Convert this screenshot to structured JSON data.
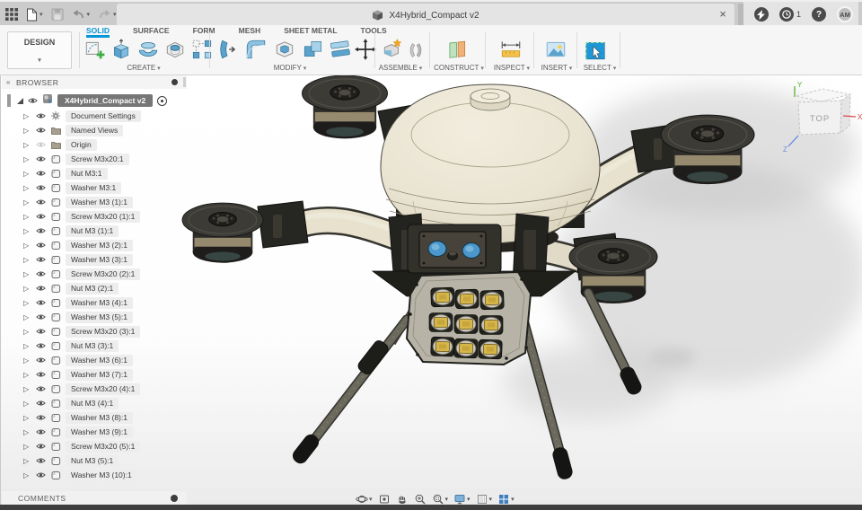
{
  "appbar": {
    "document_tab": "X4Hybrid_Compact v2",
    "job_count": "1",
    "help_label": "?",
    "avatar": "AM",
    "left_icons": [
      "app-grid",
      "file-new",
      "save",
      "undo",
      "redo"
    ],
    "right_icons": [
      "close-tab",
      "new-tab",
      "extensions",
      "job-status",
      "help",
      "account"
    ]
  },
  "ribbon": {
    "design_label": "DESIGN",
    "accent_color": "#0696d7",
    "tabs": [
      {
        "label": "SOLID",
        "active": true
      },
      {
        "label": "SURFACE",
        "active": false
      },
      {
        "label": "FORM",
        "active": false
      },
      {
        "label": "MESH",
        "active": false
      },
      {
        "label": "SHEET METAL",
        "active": false
      },
      {
        "label": "TOOLS",
        "active": false
      }
    ],
    "groups": {
      "create": "CREATE",
      "modify": "MODIFY",
      "assemble": "ASSEMBLE",
      "construct": "CONSTRUCT",
      "inspect": "INSPECT",
      "insert": "INSERT",
      "select": "SELECT"
    },
    "create_tools": [
      "create-sketch",
      "extrude",
      "revolve",
      "hole",
      "pattern"
    ],
    "modify_tools": [
      "press-pull",
      "fillet",
      "shell",
      "combine",
      "split-body",
      "move-copy"
    ],
    "assemble_tools": [
      "new-component",
      "joint"
    ]
  },
  "browser": {
    "title": "BROWSER",
    "root": {
      "label": "X4Hybrid_Compact v2",
      "selected": true
    },
    "items": [
      {
        "label": "Document Settings",
        "icon": "gear"
      },
      {
        "label": "Named Views",
        "icon": "folder"
      },
      {
        "label": "Origin",
        "icon": "folder",
        "hidden": true
      },
      {
        "label": "Screw M3x20:1",
        "icon": "component"
      },
      {
        "label": "Nut M3:1",
        "icon": "component"
      },
      {
        "label": "Washer M3:1",
        "icon": "component"
      },
      {
        "label": "Washer M3 (1):1",
        "icon": "component"
      },
      {
        "label": "Screw M3x20 (1):1",
        "icon": "component"
      },
      {
        "label": "Nut M3 (1):1",
        "icon": "component"
      },
      {
        "label": "Washer M3 (2):1",
        "icon": "component"
      },
      {
        "label": "Washer M3 (3):1",
        "icon": "component"
      },
      {
        "label": "Screw M3x20 (2):1",
        "icon": "component"
      },
      {
        "label": "Nut M3 (2):1",
        "icon": "component"
      },
      {
        "label": "Washer M3 (4):1",
        "icon": "component"
      },
      {
        "label": "Washer M3 (5):1",
        "icon": "component"
      },
      {
        "label": "Screw M3x20 (3):1",
        "icon": "component"
      },
      {
        "label": "Nut M3 (3):1",
        "icon": "component"
      },
      {
        "label": "Washer M3 (6):1",
        "icon": "component"
      },
      {
        "label": "Washer M3 (7):1",
        "icon": "component"
      },
      {
        "label": "Screw M3x20 (4):1",
        "icon": "component"
      },
      {
        "label": "Nut M3 (4):1",
        "icon": "component"
      },
      {
        "label": "Washer M3 (8):1",
        "icon": "component"
      },
      {
        "label": "Washer M3 (9):1",
        "icon": "component"
      },
      {
        "label": "Screw M3x20 (5):1",
        "icon": "component"
      },
      {
        "label": "Nut M3 (5):1",
        "icon": "component"
      },
      {
        "label": "Washer M3 (10):1",
        "icon": "component"
      }
    ],
    "comments": "COMMENTS"
  },
  "viewcube": {
    "top_label": "TOP",
    "axis_x": "X",
    "axis_y": "Y",
    "axis_z": "Z"
  },
  "viewport": {
    "navbar_icons": [
      "orbit",
      "look-at",
      "pan",
      "zoom",
      "fit",
      "display-settings",
      "grid-settings",
      "viewports"
    ]
  }
}
